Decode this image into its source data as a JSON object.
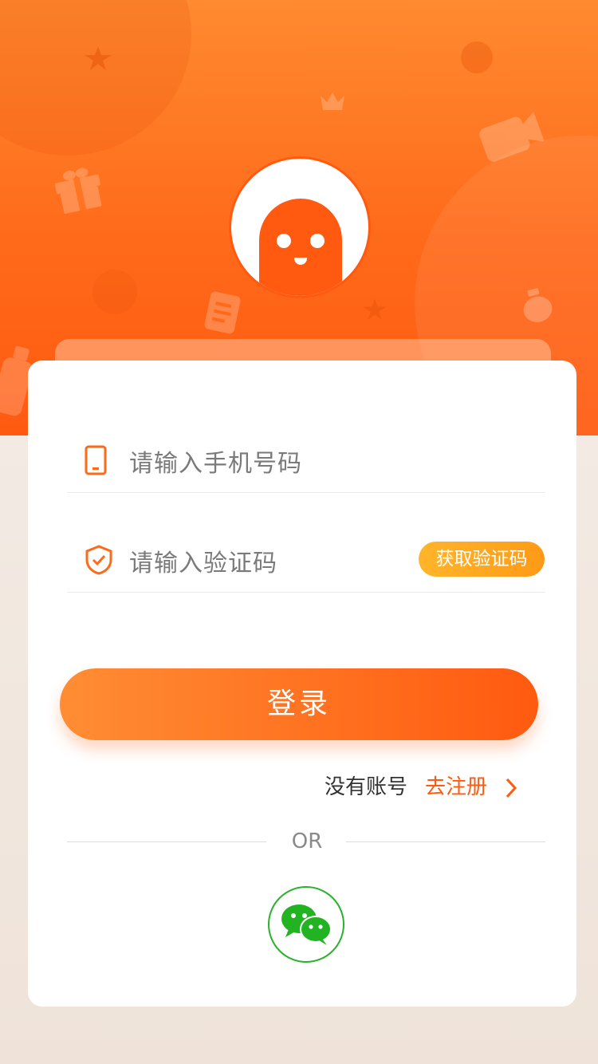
{
  "colors": {
    "brand": "#ff5a10",
    "brand_light": "#ff8d33",
    "code_button": "#ffa51f",
    "wechat": "#2bb22b"
  },
  "form": {
    "phone_placeholder": "请输入手机号码",
    "code_placeholder": "请输入验证码",
    "get_code_label": "获取验证码",
    "phone_icon": "phone-icon",
    "code_icon": "shield-check-icon"
  },
  "login_button": "登录",
  "register": {
    "prompt": "没有账号",
    "link": "去注册"
  },
  "divider_text": "OR",
  "social": {
    "icon": "wechat-icon"
  }
}
